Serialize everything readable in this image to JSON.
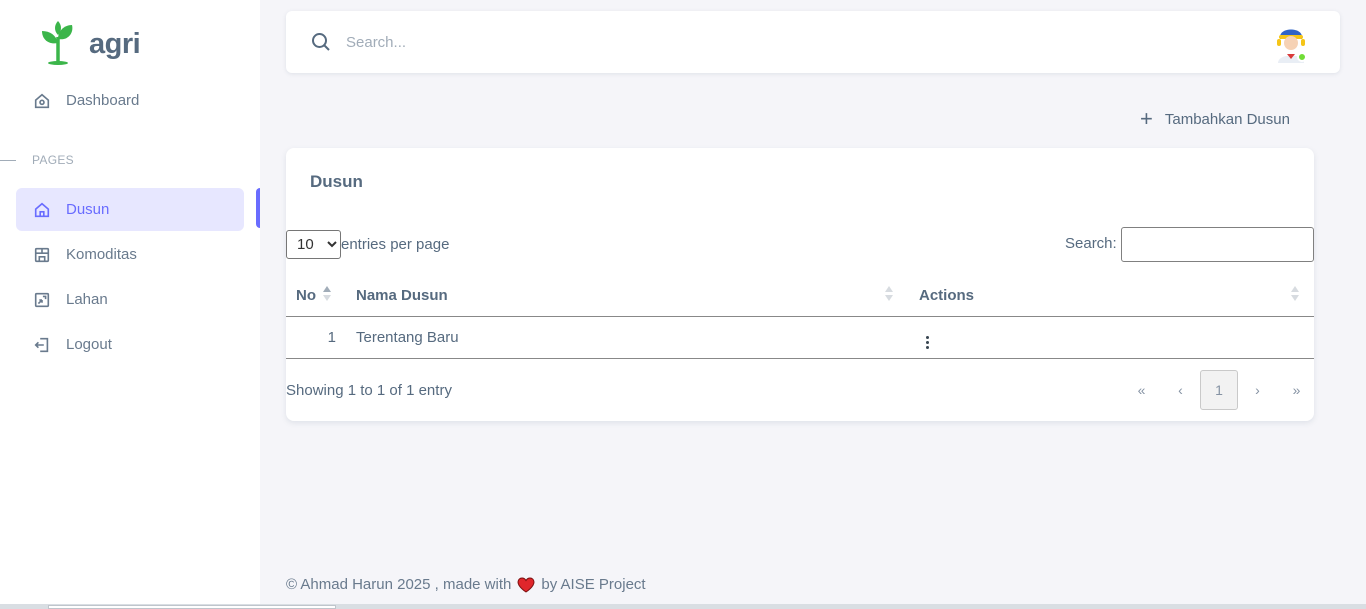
{
  "brand": {
    "name": "agri",
    "logo_icon": "sprout-icon"
  },
  "sidebar": {
    "dashboard": {
      "label": "Dashboard",
      "icon": "home-icon"
    },
    "section_header": "PAGES",
    "items": [
      {
        "label": "Dusun",
        "icon": "home-icon",
        "active": true
      },
      {
        "label": "Komoditas",
        "icon": "store-icon"
      },
      {
        "label": "Lahan",
        "icon": "map-icon"
      },
      {
        "label": "Logout",
        "icon": "logout-icon"
      }
    ]
  },
  "navbar": {
    "search_placeholder": "Search...",
    "avatar_status": "online"
  },
  "actions": {
    "add_label": "Tambahkan Dusun"
  },
  "card": {
    "title": "Dusun",
    "entries_value": "10",
    "entries_label": "entries per page",
    "search_label": "Search:",
    "columns": [
      "No",
      "Nama Dusun",
      "Actions"
    ],
    "rows": [
      {
        "no": "1",
        "nama": "Terentang Baru"
      }
    ],
    "info": "Showing 1 to 1 of 1 entry",
    "pagination": {
      "first": "«",
      "prev": "‹",
      "current": "1",
      "next": "›",
      "last": "»"
    }
  },
  "footer": {
    "prefix": "© Ahmad Harun 2025 , made with",
    "suffix": "by AISE Project"
  },
  "colors": {
    "accent": "#696cff",
    "active_bg": "#e7e7ff",
    "logo_green": "#3bb54a",
    "heart": "#e0262b"
  }
}
